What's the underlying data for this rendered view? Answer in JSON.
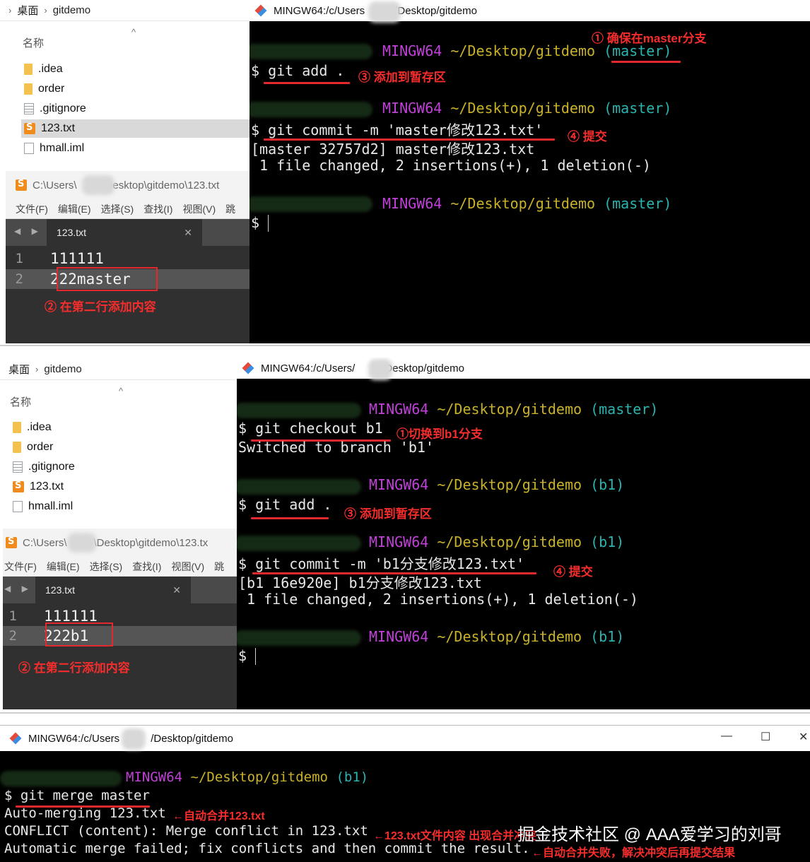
{
  "panel1": {
    "explorer": {
      "crumb_a": "桌面",
      "crumb_b": "gitdemo",
      "col_name": "名称",
      "files": [
        {
          "name": ".idea",
          "icon": "folder-icon"
        },
        {
          "name": "order",
          "icon": "folder-icon"
        },
        {
          "name": ".gitignore",
          "icon": "text-file-icon"
        },
        {
          "name": "123.txt",
          "icon": "sublime-file-icon",
          "selected": true
        },
        {
          "name": "hmall.iml",
          "icon": "file-icon"
        }
      ]
    },
    "editor": {
      "title": "C:\\Users\\",
      "title_rest": "Desktop\\gitdemo\\123.txt",
      "menu": [
        "文件(F)",
        "编辑(E)",
        "选择(S)",
        "查找(I)",
        "视图(V)",
        "跳"
      ],
      "tab": "123.txt",
      "lines": [
        {
          "n": "1",
          "t": "111111"
        },
        {
          "n": "2",
          "t": "222master"
        }
      ],
      "note": "② 在第二行添加内容"
    },
    "terminal": {
      "title_a": "MINGW64:/c/Users",
      "title_b": "/Desktop/gitdemo",
      "note_branch": "① 确保在master分支",
      "prompt_mg": "MINGW64",
      "prompt_path": "~/Desktop/gitdemo",
      "prompt_branch": "(master)",
      "cmd_add": "$ git add .",
      "note_add": "③ 添加到暂存区",
      "cmd_commit": "$ git commit -m 'master修改123.txt'",
      "note_commit": "④ 提交",
      "out1": "[master 32757d2] master修改123.txt",
      "out2": " 1 file changed, 2 insertions(+), 1 deletion(-)",
      "dollar": "$"
    }
  },
  "panel2": {
    "explorer": {
      "crumb_a": "桌面",
      "crumb_b": "gitdemo",
      "col_name": "名称",
      "files": [
        {
          "name": ".idea",
          "icon": "folder-icon"
        },
        {
          "name": "order",
          "icon": "folder-icon"
        },
        {
          "name": ".gitignore",
          "icon": "text-file-icon"
        },
        {
          "name": "123.txt",
          "icon": "sublime-file-icon"
        },
        {
          "name": "hmall.iml",
          "icon": "file-icon"
        }
      ]
    },
    "editor": {
      "title": "C:\\Users\\",
      "title_rest": "\\Desktop\\gitdemo\\123.tx",
      "menu": [
        "文件(F)",
        "编辑(E)",
        "选择(S)",
        "查找(I)",
        "视图(V)",
        "跳"
      ],
      "tab": "123.txt",
      "lines": [
        {
          "n": "1",
          "t": "111111"
        },
        {
          "n": "2",
          "t": "222b1"
        }
      ],
      "note": "② 在第二行添加内容"
    },
    "terminal": {
      "title_a": "MINGW64:/c/Users/",
      "title_b": "Desktop/gitdemo",
      "prompt_mg": "MINGW64",
      "prompt_path": "~/Desktop/gitdemo",
      "prompt_master": "(master)",
      "prompt_b1": "(b1)",
      "cmd_checkout": "$ git checkout b1",
      "note_checkout": "①切换到b1分支",
      "out_switched": "Switched to branch 'b1'",
      "cmd_add": "$ git add .",
      "note_add": "③ 添加到暂存区",
      "cmd_commit": "$ git commit -m 'b1分支修改123.txt'",
      "note_commit": "④ 提交",
      "out1": "[b1 16e920e] b1分支修改123.txt",
      "out2": " 1 file changed, 2 insertions(+), 1 deletion(-)",
      "dollar": "$"
    }
  },
  "panel3": {
    "title_a": "MINGW64:/c/Users",
    "title_b": "/Desktop/gitdemo",
    "win_min": "—",
    "win_max": "☐",
    "win_close": "✕",
    "prompt_mg": "MINGW64",
    "prompt_path": "~/Desktop/gitdemo",
    "prompt_branch": "(b1)",
    "cmd_merge": "$ git merge master",
    "out1": "Auto-merging 123.txt",
    "note1": "←自动合并123.txt",
    "out2": "CONFLICT (content): Merge conflict in 123.txt",
    "note2": "←123.txt文件内容 出现合并冲突",
    "out3": "Automatic merge failed; fix conflicts and then commit the result.",
    "note3": "←自动合并失败，解决冲突后再提交结果",
    "watermark": "掘金技术社区 @ AAA爱学习的刘哥"
  },
  "colors": {
    "annotation_red": "#f52d2d",
    "mingw_magenta": "#c040d8",
    "path_yellow": "#c9b22a",
    "branch_cyan": "#2bb3b0",
    "terminal_bg": "#000000",
    "editor_bg": "#303030"
  }
}
